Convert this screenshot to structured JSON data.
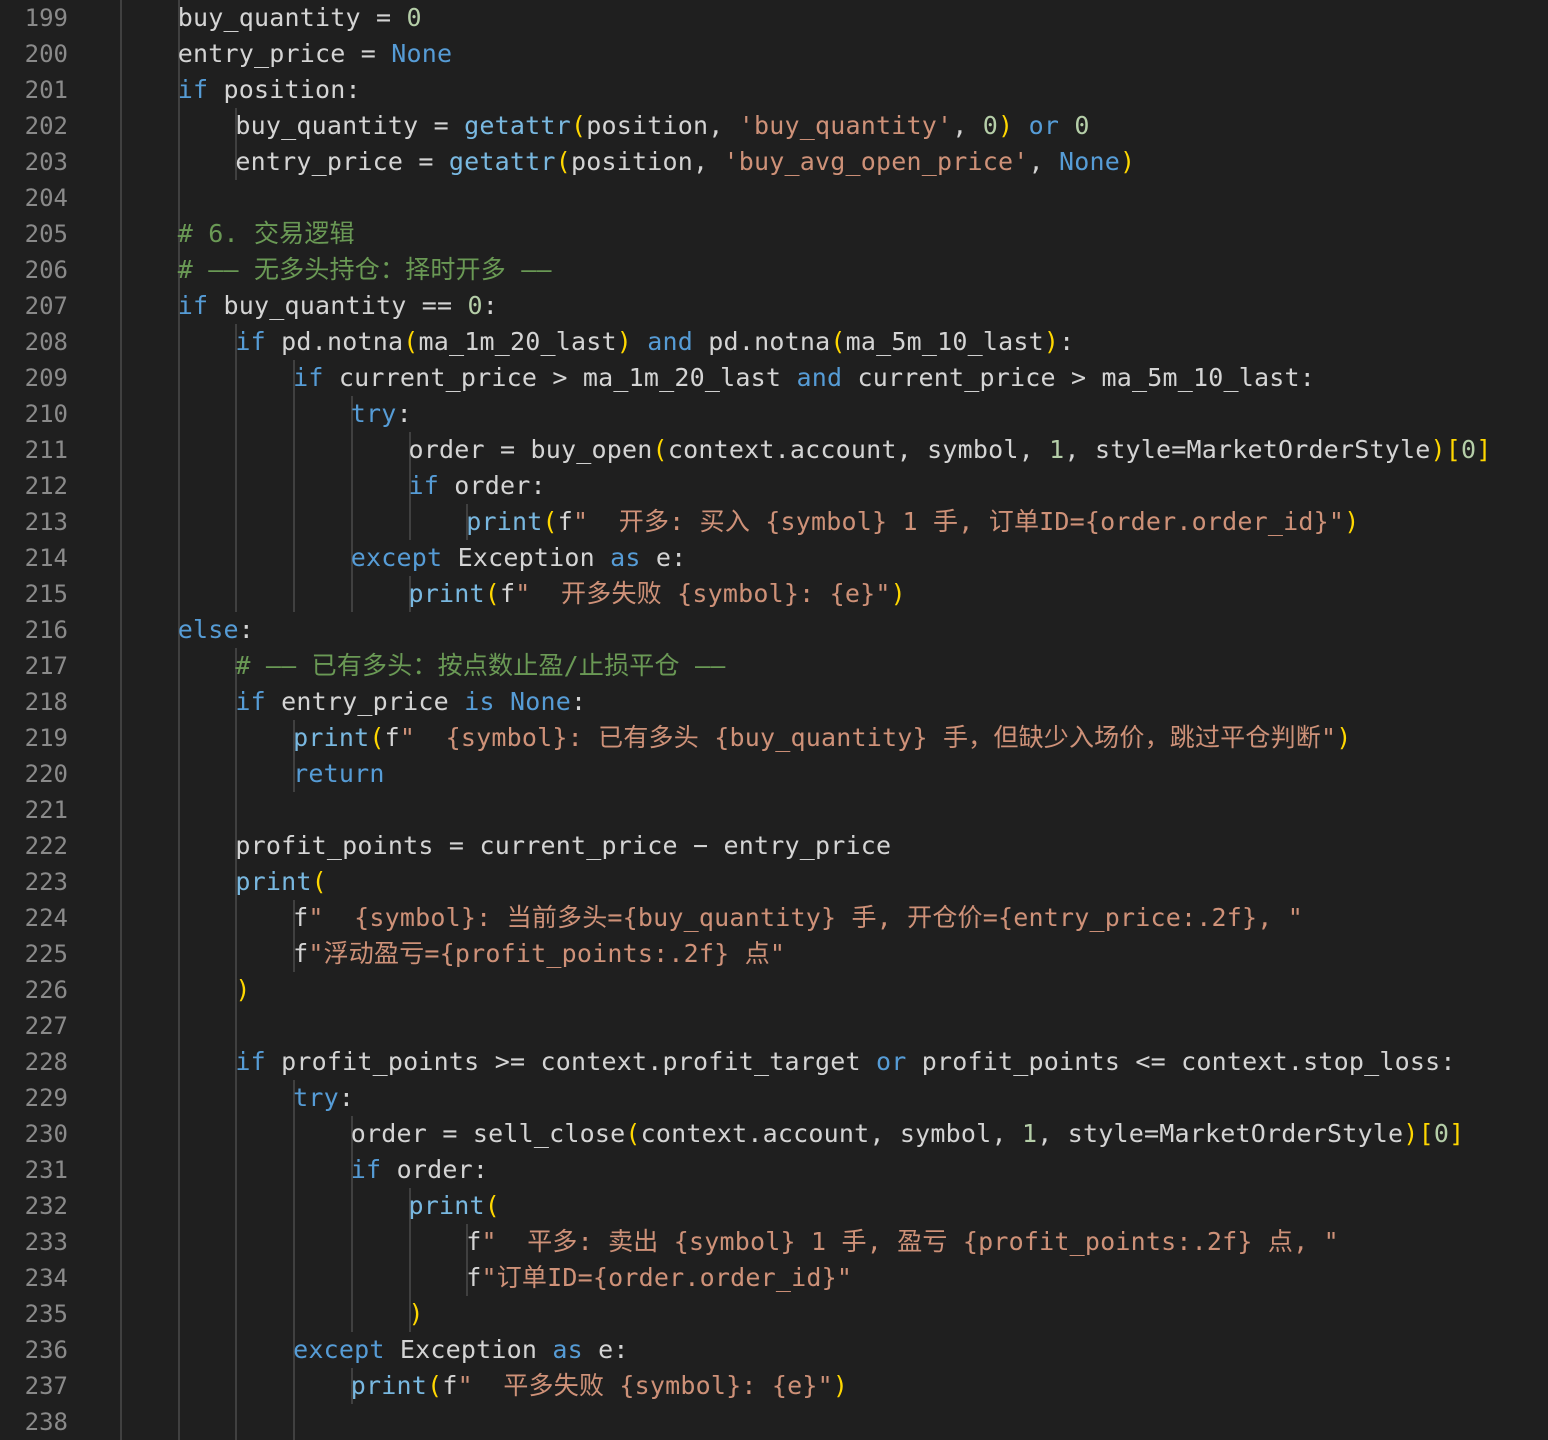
{
  "editor": {
    "language": "python",
    "colors": {
      "background": "#1f1f1f",
      "line_number": "#8a8a8a",
      "text": "#d4d4d4",
      "keyword": "#569cd6",
      "function": "#79b8e0",
      "string": "#ce9178",
      "number": "#b5cea8",
      "comment": "#6a9955",
      "bracket_level_1": "#ffd700",
      "bracket_level_2": "#da70d6",
      "indent_guide": "#404040"
    },
    "lines": [
      {
        "n": "199",
        "indent": 2,
        "tokens": [
          [
            "id",
            "buy_quantity"
          ],
          [
            "op",
            " = "
          ],
          [
            "num",
            "0"
          ]
        ]
      },
      {
        "n": "200",
        "indent": 2,
        "tokens": [
          [
            "id",
            "entry_price"
          ],
          [
            "op",
            " = "
          ],
          [
            "const",
            "None"
          ]
        ]
      },
      {
        "n": "201",
        "indent": 2,
        "tokens": [
          [
            "kw",
            "if"
          ],
          [
            "id",
            " position"
          ],
          [
            "op",
            ":"
          ]
        ]
      },
      {
        "n": "202",
        "indent": 3,
        "tokens": [
          [
            "id",
            "buy_quantity"
          ],
          [
            "op",
            " = "
          ],
          [
            "fn",
            "getattr"
          ],
          [
            "p1",
            "("
          ],
          [
            "id",
            "position"
          ],
          [
            "op",
            ", "
          ],
          [
            "str",
            "'buy_quantity'"
          ],
          [
            "op",
            ", "
          ],
          [
            "num",
            "0"
          ],
          [
            "p1",
            ")"
          ],
          [
            "op",
            " "
          ],
          [
            "kw",
            "or"
          ],
          [
            "op",
            " "
          ],
          [
            "num",
            "0"
          ]
        ]
      },
      {
        "n": "203",
        "indent": 3,
        "tokens": [
          [
            "id",
            "entry_price"
          ],
          [
            "op",
            " = "
          ],
          [
            "fn",
            "getattr"
          ],
          [
            "p1",
            "("
          ],
          [
            "id",
            "position"
          ],
          [
            "op",
            ", "
          ],
          [
            "str",
            "'buy_avg_open_price'"
          ],
          [
            "op",
            ", "
          ],
          [
            "const",
            "None"
          ],
          [
            "p1",
            ")"
          ]
        ]
      },
      {
        "n": "204",
        "indent": 2,
        "tokens": []
      },
      {
        "n": "205",
        "indent": 2,
        "tokens": [
          [
            "com",
            "# 6. 交易逻辑"
          ]
        ]
      },
      {
        "n": "206",
        "indent": 2,
        "tokens": [
          [
            "com",
            "# —— 无多头持仓：择时开多 ——"
          ]
        ]
      },
      {
        "n": "207",
        "indent": 2,
        "tokens": [
          [
            "kw",
            "if"
          ],
          [
            "id",
            " buy_quantity"
          ],
          [
            "op",
            " == "
          ],
          [
            "num",
            "0"
          ],
          [
            "op",
            ":"
          ]
        ]
      },
      {
        "n": "208",
        "indent": 3,
        "tokens": [
          [
            "kw",
            "if"
          ],
          [
            "id",
            " pd"
          ],
          [
            "op",
            "."
          ],
          [
            "id",
            "notna"
          ],
          [
            "p1",
            "("
          ],
          [
            "id",
            "ma_1m_20_last"
          ],
          [
            "p1",
            ")"
          ],
          [
            "op",
            " "
          ],
          [
            "kw",
            "and"
          ],
          [
            "id",
            " pd"
          ],
          [
            "op",
            "."
          ],
          [
            "id",
            "notna"
          ],
          [
            "p1",
            "("
          ],
          [
            "id",
            "ma_5m_10_last"
          ],
          [
            "p1",
            ")"
          ],
          [
            "op",
            ":"
          ]
        ]
      },
      {
        "n": "209",
        "indent": 4,
        "tokens": [
          [
            "kw",
            "if"
          ],
          [
            "id",
            " current_price"
          ],
          [
            "op",
            " > "
          ],
          [
            "id",
            "ma_1m_20_last"
          ],
          [
            "op",
            " "
          ],
          [
            "kw",
            "and"
          ],
          [
            "id",
            " current_price"
          ],
          [
            "op",
            " > "
          ],
          [
            "id",
            "ma_5m_10_last"
          ],
          [
            "op",
            ":"
          ]
        ]
      },
      {
        "n": "210",
        "indent": 5,
        "tokens": [
          [
            "kw",
            "try"
          ],
          [
            "op",
            ":"
          ]
        ]
      },
      {
        "n": "211",
        "indent": 6,
        "tokens": [
          [
            "id",
            "order"
          ],
          [
            "op",
            " = "
          ],
          [
            "id",
            "buy_open"
          ],
          [
            "p1",
            "("
          ],
          [
            "id",
            "context"
          ],
          [
            "op",
            "."
          ],
          [
            "id",
            "account"
          ],
          [
            "op",
            ", "
          ],
          [
            "id",
            "symbol"
          ],
          [
            "op",
            ", "
          ],
          [
            "num",
            "1"
          ],
          [
            "op",
            ", "
          ],
          [
            "id",
            "style"
          ],
          [
            "op",
            "="
          ],
          [
            "id",
            "MarketOrderStyle"
          ],
          [
            "p1",
            ")"
          ],
          [
            "p1",
            "["
          ],
          [
            "num",
            "0"
          ],
          [
            "p1",
            "]"
          ]
        ]
      },
      {
        "n": "212",
        "indent": 6,
        "tokens": [
          [
            "kw",
            "if"
          ],
          [
            "id",
            " order"
          ],
          [
            "op",
            ":"
          ]
        ]
      },
      {
        "n": "213",
        "indent": 7,
        "tokens": [
          [
            "fn",
            "print"
          ],
          [
            "p1",
            "("
          ],
          [
            "id",
            "f"
          ],
          [
            "str",
            "\"  开多: 买入 {symbol} 1 手, 订单ID={order.order_id}\""
          ],
          [
            "p1",
            ")"
          ]
        ]
      },
      {
        "n": "214",
        "indent": 5,
        "tokens": [
          [
            "kw",
            "except"
          ],
          [
            "id",
            " Exception"
          ],
          [
            "op",
            " "
          ],
          [
            "kw",
            "as"
          ],
          [
            "id",
            " e"
          ],
          [
            "op",
            ":"
          ]
        ]
      },
      {
        "n": "215",
        "indent": 6,
        "tokens": [
          [
            "fn",
            "print"
          ],
          [
            "p1",
            "("
          ],
          [
            "id",
            "f"
          ],
          [
            "str",
            "\"  开多失败 {symbol}: {e}\""
          ],
          [
            "p1",
            ")"
          ]
        ]
      },
      {
        "n": "216",
        "indent": 2,
        "tokens": [
          [
            "kw",
            "else"
          ],
          [
            "op",
            ":"
          ]
        ]
      },
      {
        "n": "217",
        "indent": 3,
        "tokens": [
          [
            "com",
            "# —— 已有多头：按点数止盈/止损平仓 ——"
          ]
        ]
      },
      {
        "n": "218",
        "indent": 3,
        "tokens": [
          [
            "kw",
            "if"
          ],
          [
            "id",
            " entry_price"
          ],
          [
            "op",
            " "
          ],
          [
            "kw",
            "is"
          ],
          [
            "op",
            " "
          ],
          [
            "const",
            "None"
          ],
          [
            "op",
            ":"
          ]
        ]
      },
      {
        "n": "219",
        "indent": 4,
        "tokens": [
          [
            "fn",
            "print"
          ],
          [
            "p1",
            "("
          ],
          [
            "id",
            "f"
          ],
          [
            "str",
            "\"  {symbol}: 已有多头 {buy_quantity} 手，但缺少入场价，跳过平仓判断\""
          ],
          [
            "p1",
            ")"
          ]
        ]
      },
      {
        "n": "220",
        "indent": 4,
        "tokens": [
          [
            "kw",
            "return"
          ]
        ]
      },
      {
        "n": "221",
        "indent": 3,
        "tokens": []
      },
      {
        "n": "222",
        "indent": 3,
        "tokens": [
          [
            "id",
            "profit_points"
          ],
          [
            "op",
            " = "
          ],
          [
            "id",
            "current_price"
          ],
          [
            "op",
            " − "
          ],
          [
            "id",
            "entry_price"
          ]
        ]
      },
      {
        "n": "223",
        "indent": 3,
        "tokens": [
          [
            "fn",
            "print"
          ],
          [
            "p1",
            "("
          ]
        ]
      },
      {
        "n": "224",
        "indent": 4,
        "tokens": [
          [
            "id",
            "f"
          ],
          [
            "str",
            "\"  {symbol}: 当前多头={buy_quantity} 手, 开仓价={entry_price:.2f}, \""
          ]
        ]
      },
      {
        "n": "225",
        "indent": 4,
        "tokens": [
          [
            "id",
            "f"
          ],
          [
            "str",
            "\"浮动盈亏={profit_points:.2f} 点\""
          ]
        ]
      },
      {
        "n": "226",
        "indent": 3,
        "tokens": [
          [
            "p1",
            ")"
          ]
        ]
      },
      {
        "n": "227",
        "indent": 3,
        "tokens": []
      },
      {
        "n": "228",
        "indent": 3,
        "tokens": [
          [
            "kw",
            "if"
          ],
          [
            "id",
            " profit_points"
          ],
          [
            "op",
            " >= "
          ],
          [
            "id",
            "context"
          ],
          [
            "op",
            "."
          ],
          [
            "id",
            "profit_target"
          ],
          [
            "op",
            " "
          ],
          [
            "kw",
            "or"
          ],
          [
            "id",
            " profit_points"
          ],
          [
            "op",
            " <= "
          ],
          [
            "id",
            "context"
          ],
          [
            "op",
            "."
          ],
          [
            "id",
            "stop_loss"
          ],
          [
            "op",
            ":"
          ]
        ]
      },
      {
        "n": "229",
        "indent": 4,
        "tokens": [
          [
            "kw",
            "try"
          ],
          [
            "op",
            ":"
          ]
        ]
      },
      {
        "n": "230",
        "indent": 5,
        "tokens": [
          [
            "id",
            "order"
          ],
          [
            "op",
            " = "
          ],
          [
            "id",
            "sell_close"
          ],
          [
            "p1",
            "("
          ],
          [
            "id",
            "context"
          ],
          [
            "op",
            "."
          ],
          [
            "id",
            "account"
          ],
          [
            "op",
            ", "
          ],
          [
            "id",
            "symbol"
          ],
          [
            "op",
            ", "
          ],
          [
            "num",
            "1"
          ],
          [
            "op",
            ", "
          ],
          [
            "id",
            "style"
          ],
          [
            "op",
            "="
          ],
          [
            "id",
            "MarketOrderStyle"
          ],
          [
            "p1",
            ")"
          ],
          [
            "p1",
            "["
          ],
          [
            "num",
            "0"
          ],
          [
            "p1",
            "]"
          ]
        ]
      },
      {
        "n": "231",
        "indent": 5,
        "tokens": [
          [
            "kw",
            "if"
          ],
          [
            "id",
            " order"
          ],
          [
            "op",
            ":"
          ]
        ]
      },
      {
        "n": "232",
        "indent": 6,
        "tokens": [
          [
            "fn",
            "print"
          ],
          [
            "p1",
            "("
          ]
        ]
      },
      {
        "n": "233",
        "indent": 7,
        "tokens": [
          [
            "id",
            "f"
          ],
          [
            "str",
            "\"  平多: 卖出 {symbol} 1 手, 盈亏 {profit_points:.2f} 点, \""
          ]
        ]
      },
      {
        "n": "234",
        "indent": 7,
        "tokens": [
          [
            "id",
            "f"
          ],
          [
            "str",
            "\"订单ID={order.order_id}\""
          ]
        ]
      },
      {
        "n": "235",
        "indent": 6,
        "tokens": [
          [
            "p1",
            ")"
          ]
        ]
      },
      {
        "n": "236",
        "indent": 4,
        "tokens": [
          [
            "kw",
            "except"
          ],
          [
            "id",
            " Exception"
          ],
          [
            "op",
            " "
          ],
          [
            "kw",
            "as"
          ],
          [
            "id",
            " e"
          ],
          [
            "op",
            ":"
          ]
        ]
      },
      {
        "n": "237",
        "indent": 5,
        "tokens": [
          [
            "fn",
            "print"
          ],
          [
            "p1",
            "("
          ],
          [
            "id",
            "f"
          ],
          [
            "str",
            "\"  平多失败 {symbol}: {e}\""
          ],
          [
            "p1",
            ")"
          ]
        ]
      },
      {
        "n": "238",
        "indent": 4,
        "tokens": []
      }
    ]
  }
}
